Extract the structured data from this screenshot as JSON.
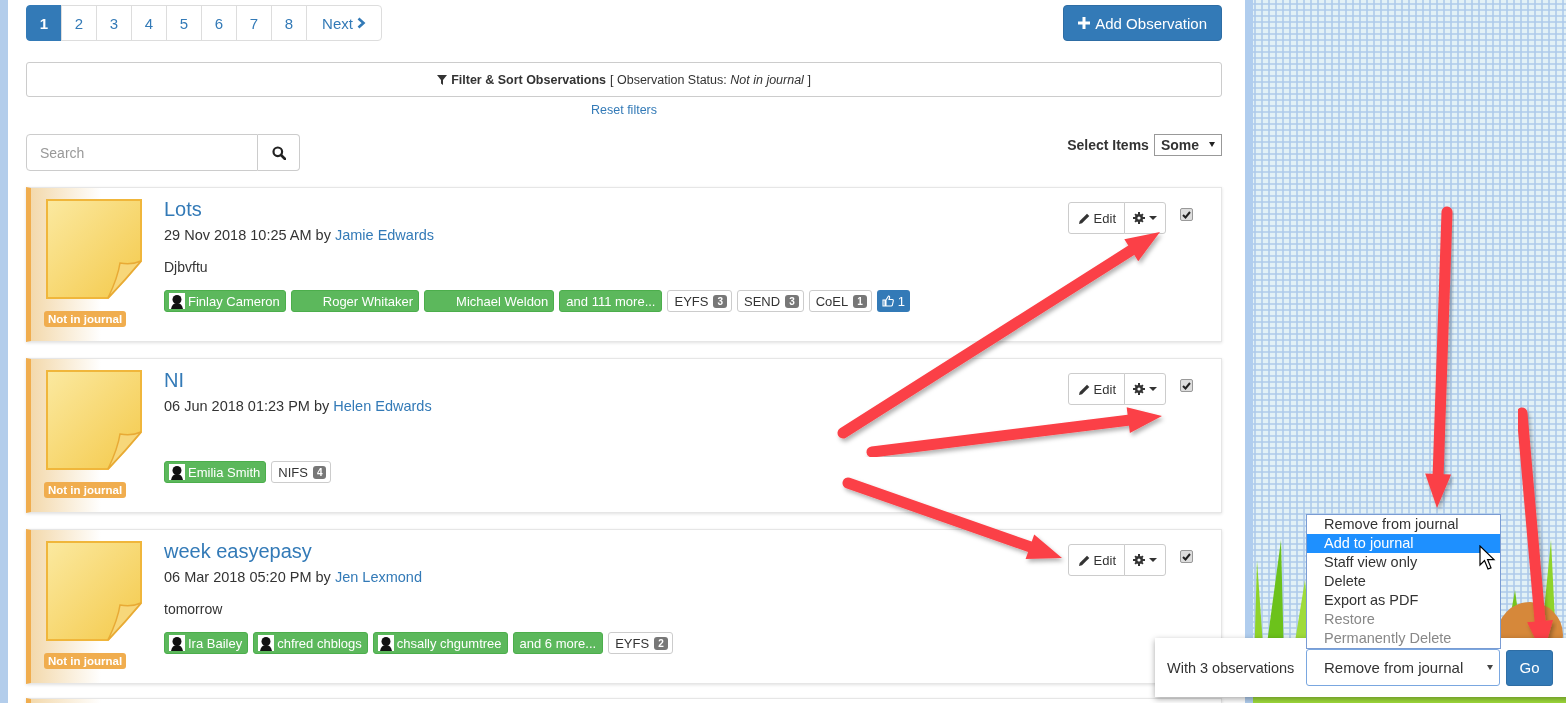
{
  "pagination": {
    "pages": [
      {
        "label": "1",
        "selected": true
      },
      {
        "label": "2",
        "selected": false
      },
      {
        "label": "3",
        "selected": false
      },
      {
        "label": "4",
        "selected": false
      },
      {
        "label": "5",
        "selected": false
      },
      {
        "label": "6",
        "selected": false
      },
      {
        "label": "7",
        "selected": false
      },
      {
        "label": "8",
        "selected": false
      }
    ],
    "next": "Next"
  },
  "add_button": "Add Observation",
  "filter": {
    "title": "Filter & Sort Observations",
    "status": "[ Observation Status: *Not in journal* ]",
    "reset": "Reset filters"
  },
  "search": {
    "placeholder": "Search"
  },
  "select_items": {
    "label": "Select Items",
    "value": "Some"
  },
  "observations": [
    {
      "title": "Lots",
      "date": "29 Nov 2018 10:25 AM",
      "by": "by",
      "author": "Jamie Edwards",
      "note": "Djbvftu",
      "status": "Not in journal",
      "edit": "Edit",
      "checked": true,
      "tags": [
        {
          "kind": "child",
          "label": "Finlay Cameron",
          "avatar": true
        },
        {
          "kind": "child",
          "label": "Roger Whitaker",
          "avatar": false
        },
        {
          "kind": "child",
          "label": "Michael Weldon",
          "avatar": false
        },
        {
          "kind": "more",
          "label": "and 111 more..."
        },
        {
          "kind": "framework",
          "label": "EYFS",
          "count": "3"
        },
        {
          "kind": "framework",
          "label": "SEND",
          "count": "3"
        },
        {
          "kind": "framework",
          "label": "CoEL",
          "count": "1"
        },
        {
          "kind": "like",
          "count": "1"
        }
      ]
    },
    {
      "title": "NI",
      "date": "06 Jun 2018 01:23 PM",
      "by": "by",
      "author": "Helen Edwards",
      "status": "Not in journal",
      "edit": "Edit",
      "checked": true,
      "tags": [
        {
          "kind": "child",
          "label": "Emilia Smith",
          "avatar": true
        },
        {
          "kind": "framework",
          "label": "NIFS",
          "count": "4"
        }
      ]
    },
    {
      "title": "week easyepasy",
      "date": "06 Mar 2018 05:20 PM",
      "by": "by",
      "author": "Jen Lexmond",
      "note": "tomorrow",
      "status": "Not in journal",
      "edit": "Edit",
      "checked": true,
      "tags": [
        {
          "kind": "child",
          "label": "Ira Bailey",
          "avatar": true
        },
        {
          "kind": "child",
          "label": "chfred chblogs",
          "avatar": true
        },
        {
          "kind": "child",
          "label": "chsally chgumtree",
          "avatar": true
        },
        {
          "kind": "more",
          "label": "and 6 more..."
        },
        {
          "kind": "framework",
          "label": "EYFS",
          "count": "2"
        }
      ]
    }
  ],
  "bulk": {
    "label": "With 3 observations",
    "value": "Remove from journal",
    "go": "Go",
    "options": [
      {
        "label": "Remove from journal",
        "highlighted": false,
        "disabled": false
      },
      {
        "label": "Add to journal",
        "highlighted": true,
        "disabled": false
      },
      {
        "label": "Staff view only",
        "highlighted": false,
        "disabled": false
      },
      {
        "label": "Delete",
        "highlighted": false,
        "disabled": false
      },
      {
        "label": "Export as PDF",
        "highlighted": false,
        "disabled": false
      },
      {
        "label": "Restore",
        "highlighted": false,
        "disabled": true
      },
      {
        "label": "Permanently Delete",
        "highlighted": false,
        "disabled": true
      }
    ]
  }
}
